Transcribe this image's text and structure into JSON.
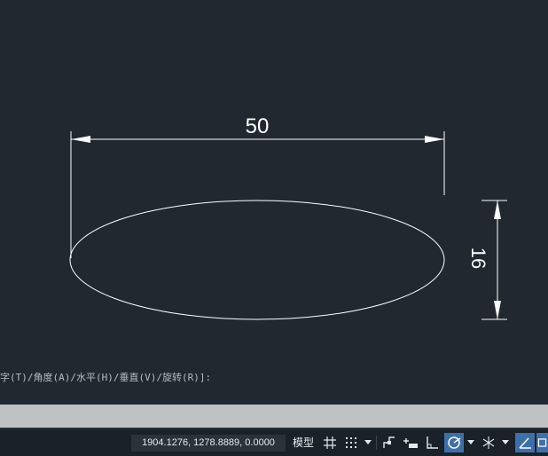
{
  "drawing": {
    "dim_width_text": "50",
    "dim_height_text": "16"
  },
  "command_line": {
    "prompt": "字(T)/角度(A)/水平(H)/垂直(V)/旋转(R)]:"
  },
  "status_bar": {
    "coordinates": "1904.1276, 1278.8889, 0.0000",
    "model_label": "模型",
    "buttons": [
      {
        "name": "grid-icon",
        "active": false
      },
      {
        "name": "snap-icon",
        "active": false
      },
      {
        "name": "infer-constraints-icon",
        "active": false
      },
      {
        "name": "dynamic-input-icon",
        "active": false
      },
      {
        "name": "ortho-icon",
        "active": false
      },
      {
        "name": "polar-tracking-icon",
        "active": true
      },
      {
        "name": "isodraft-icon",
        "active": false
      },
      {
        "name": "object-snap-tracking-icon",
        "active": true
      }
    ]
  },
  "colors": {
    "canvas_bg": "#212830",
    "geometry": "#ffffff",
    "status_active": "#3e6fa8"
  }
}
